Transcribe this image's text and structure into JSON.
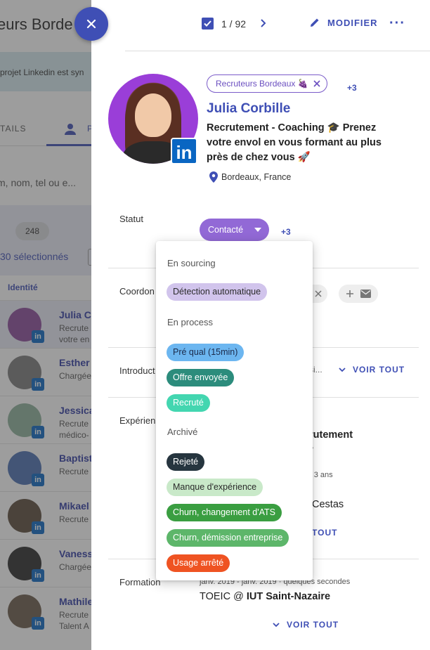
{
  "background": {
    "title": "eurs Borde",
    "banner_text": "projet Linkedin est syn",
    "tab_details": "TAILS",
    "tab_people": "P",
    "search_placeholder": "m, nom, tel ou e...",
    "count": "248",
    "selected_text": "30 sélectionnés",
    "column_header": "Identité",
    "rows": [
      {
        "name": "Julia C",
        "line1": "Recrute",
        "line2": "votre en"
      },
      {
        "name": "Esther",
        "line1": "Chargée",
        "line2": ""
      },
      {
        "name": "Jessica",
        "line1": "Recrute",
        "line2": "médico-"
      },
      {
        "name": "Baptist",
        "line1": "Recrute",
        "line2": ""
      },
      {
        "name": "Mikael",
        "line1": "Recrute",
        "line2": ""
      },
      {
        "name": "Vaness",
        "line1": "Chargée",
        "line2": ""
      },
      {
        "name": "Mathile",
        "line1": "Recrute",
        "line2": "Talent A"
      }
    ]
  },
  "topbar": {
    "counter": "1 / 92",
    "edit_label": "MODIFIER",
    "more_label": "···"
  },
  "profile": {
    "tag": "Recruteurs Bordeaux 🍇",
    "tag_more": "+3",
    "name": "Julia Corbille",
    "headline": "Recrutement - Coaching 🎓 Prenez votre envol en vous formant au plus près de chez vous 🚀",
    "location": "Bordeaux, France",
    "linkedin_badge": "in"
  },
  "sections": {
    "statut": "Statut",
    "coordonnees": "Coordon",
    "introduction": "Introduct",
    "experience": "Expérien",
    "formation": "Formation"
  },
  "status": {
    "current": "Contacté",
    "more": "+3"
  },
  "contact": {
    "chip_text": "r"
  },
  "introduction": {
    "tail": "si...",
    "voir_tout": "VOIR TOUT"
  },
  "experience": {
    "title": "rutement",
    "sub": "y",
    "duration": "· 3 ans",
    "location": "Cestas",
    "voir_tout": "TOUT"
  },
  "formation": {
    "dates": "janv. 2019 - janv. 2019 · quelques secondes",
    "degree": "TOEIC @ ",
    "school": "IUT Saint-Nazaire",
    "voir_tout": "VOIR TOUT"
  },
  "dropdown": {
    "groups": [
      {
        "label": "En sourcing",
        "options": [
          {
            "label": "Détection automatique",
            "bg": "#d1c4ec",
            "fg": "#2b2b2b"
          }
        ]
      },
      {
        "label": "En process",
        "options": [
          {
            "label": "Pré qual (15min)",
            "bg": "#6cb6f0",
            "fg": "#1b2a4a"
          },
          {
            "label": "Offre envoyée",
            "bg": "#2c8c7c",
            "fg": "#ffffff"
          },
          {
            "label": "Recruté",
            "bg": "#43d6b0",
            "fg": "#ffffff"
          }
        ]
      },
      {
        "label": "Archivé",
        "options": [
          {
            "label": "Rejeté",
            "bg": "#26353f",
            "fg": "#ffffff"
          },
          {
            "label": "Manque d'expérience",
            "bg": "#c9e9c9",
            "fg": "#2b2b2b"
          },
          {
            "label": "Churn, changement d'ATS",
            "bg": "#3a9e41",
            "fg": "#ffffff"
          },
          {
            "label": "Churn, démission entreprise",
            "bg": "#5db66a",
            "fg": "#ffffff"
          },
          {
            "label": "Usage arrêté",
            "bg": "#ef5322",
            "fg": "#ffffff"
          }
        ]
      }
    ]
  },
  "colors": {
    "primary": "#3f4fb5",
    "status": "#9269d6",
    "linkedin": "#0a66c2"
  }
}
